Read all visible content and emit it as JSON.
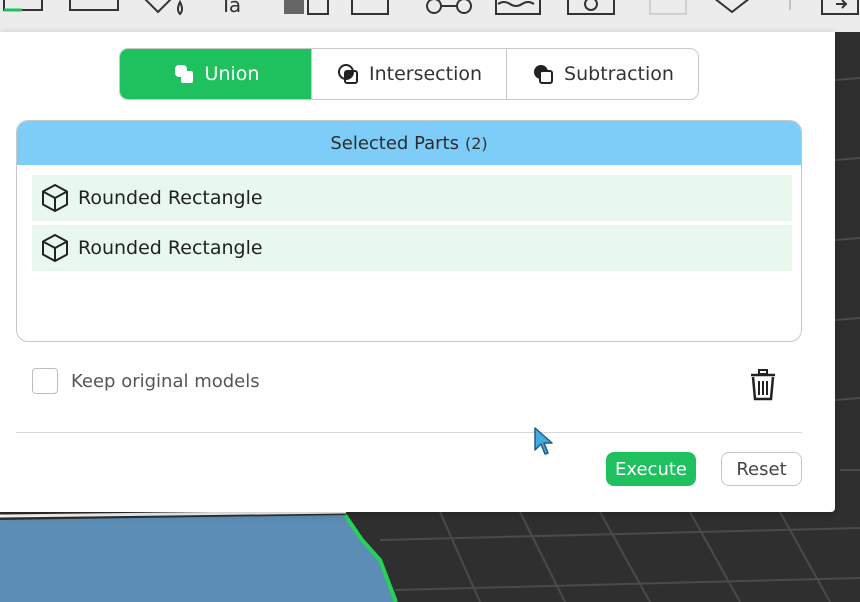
{
  "operations": {
    "union": "Union",
    "intersection": "Intersection",
    "subtraction": "Subtraction",
    "active": "union"
  },
  "parts": {
    "title": "Selected Parts",
    "count": "(2)",
    "items": [
      {
        "label": "Rounded Rectangle",
        "icon": "cube-icon"
      },
      {
        "label": "Rounded Rectangle",
        "icon": "cube-icon"
      }
    ]
  },
  "options": {
    "keep_original_label": "Keep original models",
    "keep_original_checked": false
  },
  "actions": {
    "execute_label": "Execute",
    "reset_label": "Reset"
  },
  "colors": {
    "accent_green": "#1fc15f",
    "header_blue": "#7ecdf9",
    "row_bg": "#e8f8ee"
  }
}
